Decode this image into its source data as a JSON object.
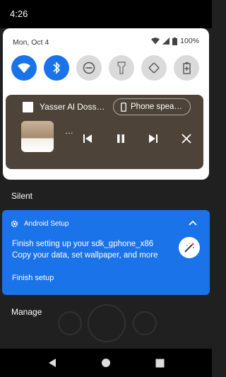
{
  "status_bar": {
    "time": "4:26"
  },
  "quick_settings": {
    "date": "Mon, Oct 4",
    "battery": "100%",
    "tiles": [
      {
        "icon": "wifi-icon",
        "state": "on"
      },
      {
        "icon": "bluetooth-icon",
        "state": "on"
      },
      {
        "icon": "do-not-disturb-icon",
        "state": "off"
      },
      {
        "icon": "flashlight-icon",
        "state": "off"
      },
      {
        "icon": "auto-rotate-icon",
        "state": "off"
      },
      {
        "icon": "battery-saver-icon",
        "state": "off"
      }
    ]
  },
  "media": {
    "title": "Yasser Al Doss…",
    "output": "Phone spea…",
    "ellipsis": "…"
  },
  "silent_label": "Silent",
  "notification": {
    "app": "Android Setup",
    "title": "Finish setting up your sdk_gphone_x86",
    "text": "Copy your data, set wallpaper, and more",
    "action": "Finish setup"
  },
  "manage_label": "Manage",
  "colors": {
    "accent": "#1a73e8",
    "media_bg": "#4e4338",
    "panel_bg": "#ffffff"
  }
}
